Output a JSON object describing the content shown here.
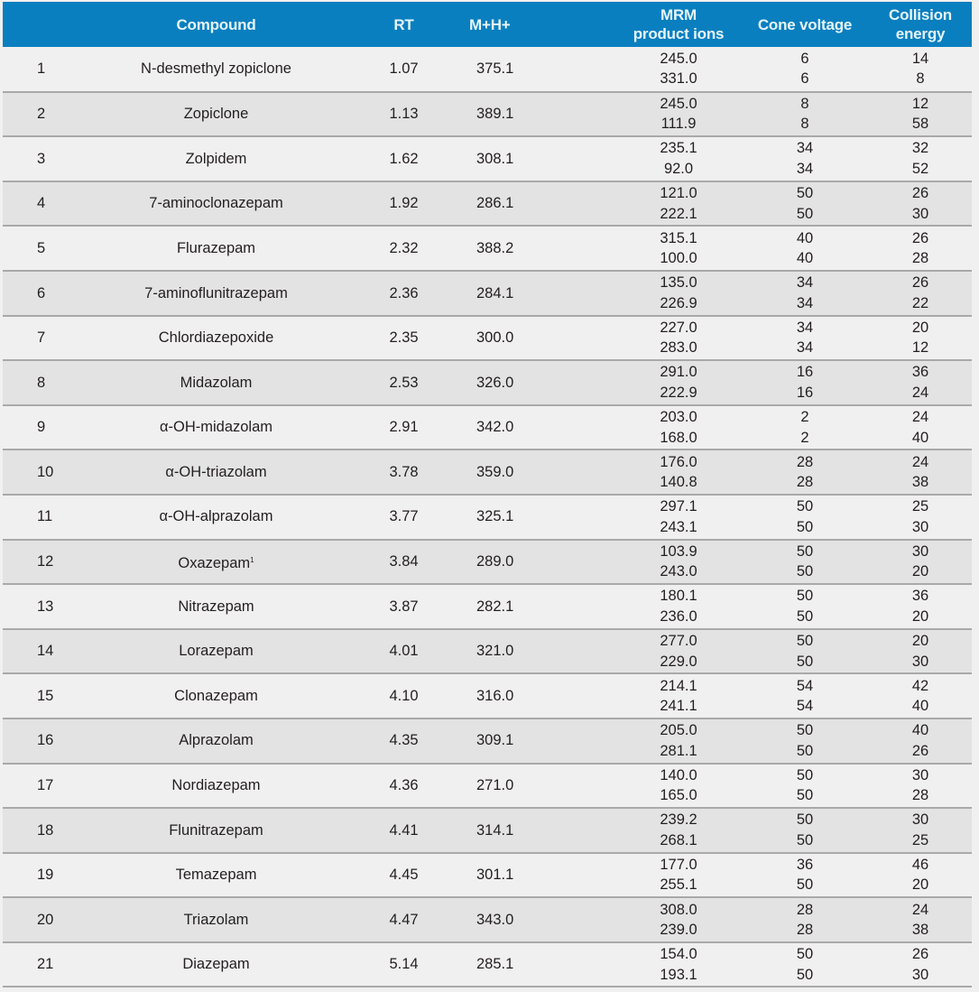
{
  "table": {
    "header_color": "#0a7fbf",
    "columns": {
      "num": "",
      "compound": "Compound",
      "rt": "RT",
      "mh": "M+H+",
      "mrm_line1": "MRM",
      "mrm_line2": "product ions",
      "cone": "Cone voltage",
      "collision_line1": "Collision",
      "collision_line2": "energy"
    },
    "rows": [
      {
        "num": "1",
        "compound": "N-desmethyl zopiclone",
        "sup": "",
        "rt": "1.07",
        "mh": "375.1",
        "mrm": [
          "245.0",
          "331.0"
        ],
        "cone": [
          "6",
          "6"
        ],
        "ce": [
          "14",
          "8"
        ]
      },
      {
        "num": "2",
        "compound": "Zopiclone",
        "sup": "",
        "rt": "1.13",
        "mh": "389.1",
        "mrm": [
          "245.0",
          "111.9"
        ],
        "cone": [
          "8",
          "8"
        ],
        "ce": [
          "12",
          "58"
        ]
      },
      {
        "num": "3",
        "compound": "Zolpidem",
        "sup": "",
        "rt": "1.62",
        "mh": "308.1",
        "mrm": [
          "235.1",
          "92.0"
        ],
        "cone": [
          "34",
          "34"
        ],
        "ce": [
          "32",
          "52"
        ]
      },
      {
        "num": "4",
        "compound": "7-aminoclonazepam",
        "sup": "",
        "rt": "1.92",
        "mh": "286.1",
        "mrm": [
          "121.0",
          "222.1"
        ],
        "cone": [
          "50",
          "50"
        ],
        "ce": [
          "26",
          "30"
        ]
      },
      {
        "num": "5",
        "compound": "Flurazepam",
        "sup": "",
        "rt": "2.32",
        "mh": "388.2",
        "mrm": [
          "315.1",
          "100.0"
        ],
        "cone": [
          "40",
          "40"
        ],
        "ce": [
          "26",
          "28"
        ]
      },
      {
        "num": "6",
        "compound": "7-aminoflunitrazepam",
        "sup": "",
        "rt": "2.36",
        "mh": "284.1",
        "mrm": [
          "135.0",
          "226.9"
        ],
        "cone": [
          "34",
          "34"
        ],
        "ce": [
          "26",
          "22"
        ]
      },
      {
        "num": "7",
        "compound": "Chlordiazepoxide",
        "sup": "",
        "rt": "2.35",
        "mh": "300.0",
        "mrm": [
          "227.0",
          "283.0"
        ],
        "cone": [
          "34",
          "34"
        ],
        "ce": [
          "20",
          "12"
        ]
      },
      {
        "num": "8",
        "compound": "Midazolam",
        "sup": "",
        "rt": "2.53",
        "mh": "326.0",
        "mrm": [
          "291.0",
          "222.9"
        ],
        "cone": [
          "16",
          "16"
        ],
        "ce": [
          "36",
          "24"
        ]
      },
      {
        "num": "9",
        "compound": "α-OH-midazolam",
        "sup": "",
        "rt": "2.91",
        "mh": "342.0",
        "mrm": [
          "203.0",
          "168.0"
        ],
        "cone": [
          "2",
          "2"
        ],
        "ce": [
          "24",
          "40"
        ]
      },
      {
        "num": "10",
        "compound": "α-OH-triazolam",
        "sup": "",
        "rt": "3.78",
        "mh": "359.0",
        "mrm": [
          "176.0",
          "140.8"
        ],
        "cone": [
          "28",
          "28"
        ],
        "ce": [
          "24",
          "38"
        ]
      },
      {
        "num": "11",
        "compound": "α-OH-alprazolam",
        "sup": "",
        "rt": "3.77",
        "mh": "325.1",
        "mrm": [
          "297.1",
          "243.1"
        ],
        "cone": [
          "50",
          "50"
        ],
        "ce": [
          "25",
          "30"
        ]
      },
      {
        "num": "12",
        "compound": "Oxazepam",
        "sup": "1",
        "rt": "3.84",
        "mh": "289.0",
        "mrm": [
          "103.9",
          "243.0"
        ],
        "cone": [
          "50",
          "50"
        ],
        "ce": [
          "30",
          "20"
        ]
      },
      {
        "num": "13",
        "compound": "Nitrazepam",
        "sup": "",
        "rt": "3.87",
        "mh": "282.1",
        "mrm": [
          "180.1",
          "236.0"
        ],
        "cone": [
          "50",
          "50"
        ],
        "ce": [
          "36",
          "20"
        ]
      },
      {
        "num": "14",
        "compound": "Lorazepam",
        "sup": "",
        "rt": "4.01",
        "mh": "321.0",
        "mrm": [
          "277.0",
          "229.0"
        ],
        "cone": [
          "50",
          "50"
        ],
        "ce": [
          "20",
          "30"
        ]
      },
      {
        "num": "15",
        "compound": "Clonazepam",
        "sup": "",
        "rt": "4.10",
        "mh": "316.0",
        "mrm": [
          "214.1",
          "241.1"
        ],
        "cone": [
          "54",
          "54"
        ],
        "ce": [
          "42",
          "40"
        ]
      },
      {
        "num": "16",
        "compound": "Alprazolam",
        "sup": "",
        "rt": "4.35",
        "mh": "309.1",
        "mrm": [
          "205.0",
          "281.1"
        ],
        "cone": [
          "50",
          "50"
        ],
        "ce": [
          "40",
          "26"
        ]
      },
      {
        "num": "17",
        "compound": "Nordiazepam",
        "sup": "",
        "rt": "4.36",
        "mh": "271.0",
        "mrm": [
          "140.0",
          "165.0"
        ],
        "cone": [
          "50",
          "50"
        ],
        "ce": [
          "30",
          "28"
        ]
      },
      {
        "num": "18",
        "compound": "Flunitrazepam",
        "sup": "",
        "rt": "4.41",
        "mh": "314.1",
        "mrm": [
          "239.2",
          "268.1"
        ],
        "cone": [
          "50",
          "50"
        ],
        "ce": [
          "30",
          "25"
        ]
      },
      {
        "num": "19",
        "compound": "Temazepam",
        "sup": "",
        "rt": "4.45",
        "mh": "301.1",
        "mrm": [
          "177.0",
          "255.1"
        ],
        "cone": [
          "36",
          "50"
        ],
        "ce": [
          "46",
          "20"
        ]
      },
      {
        "num": "20",
        "compound": "Triazolam",
        "sup": "",
        "rt": "4.47",
        "mh": "343.0",
        "mrm": [
          "308.0",
          "239.0"
        ],
        "cone": [
          "28",
          "28"
        ],
        "ce": [
          "24",
          "38"
        ]
      },
      {
        "num": "21",
        "compound": "Diazepam",
        "sup": "",
        "rt": "5.14",
        "mh": "285.1",
        "mrm": [
          "154.0",
          "193.1"
        ],
        "cone": [
          "50",
          "50"
        ],
        "ce": [
          "26",
          "30"
        ]
      }
    ]
  }
}
